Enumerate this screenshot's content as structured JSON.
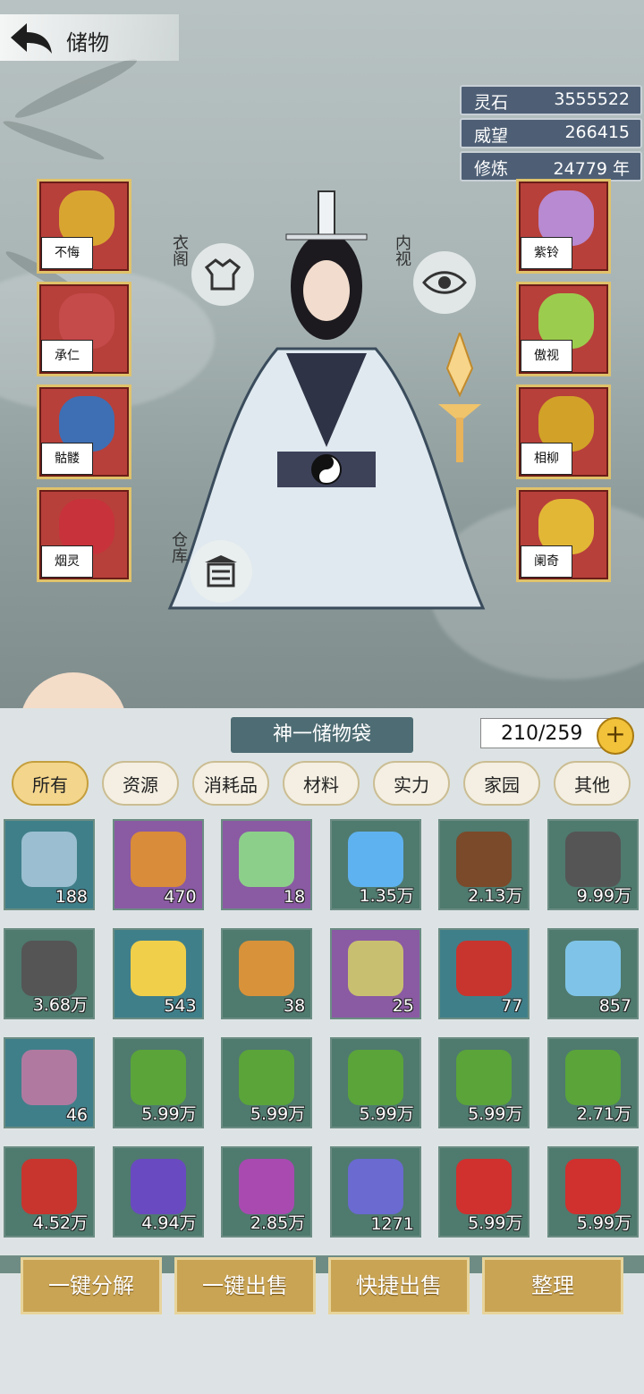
{
  "header": {
    "title": "储物"
  },
  "resources": [
    {
      "label": "灵石",
      "value": "3555522"
    },
    {
      "label": "威望",
      "value": "266415"
    },
    {
      "label": "修炼",
      "value": "24779 年"
    }
  ],
  "buttons": {
    "wardrobe": "衣阁",
    "inner_view": "内视",
    "warehouse": "仓库"
  },
  "equip_left": [
    {
      "seal": "不悔",
      "icon": "golden-sword-icon",
      "color": "#d9a531"
    },
    {
      "seal": "承仁",
      "icon": "helmet-icon",
      "color": "#c54a4a"
    },
    {
      "seal": "骷髅",
      "icon": "armor-icon",
      "color": "#3e6fb4"
    },
    {
      "seal": "烟灵",
      "icon": "boots-icon",
      "color": "#c8323a"
    }
  ],
  "equip_right": [
    {
      "seal": "紫铃",
      "icon": "ring-icon",
      "color": "#b78ad1"
    },
    {
      "seal": "傲视",
      "icon": "flower-pendant-icon",
      "color": "#9ccc4e"
    },
    {
      "seal": "相柳",
      "icon": "claw-ring-icon",
      "color": "#d1a227"
    },
    {
      "seal": "阑奇",
      "icon": "amulet-icon",
      "color": "#e2b736"
    }
  ],
  "bag": {
    "name": "神一储物袋",
    "capacity": "210/259"
  },
  "tabs": [
    "所有",
    "资源",
    "消耗品",
    "材料",
    "实力",
    "家园",
    "其他"
  ],
  "items": [
    {
      "icon": "spirit-crystal-icon",
      "count": "188",
      "bg": "#3f7f8a",
      "c": "#9bbfd0"
    },
    {
      "icon": "scroll-icon",
      "count": "470",
      "bg": "#8a5aa3",
      "c": "#d98c3a"
    },
    {
      "icon": "jade-icon",
      "count": "18",
      "bg": "#8a5aa3",
      "c": "#8ccf8a"
    },
    {
      "icon": "blue-crystal-icon",
      "count": "1.35万",
      "bg": "#4f7a6e",
      "c": "#5fb2f0"
    },
    {
      "icon": "root-icon",
      "count": "2.13万",
      "bg": "#4f7a6e",
      "c": "#7a4a2a"
    },
    {
      "icon": "ore-icon",
      "count": "9.99万",
      "bg": "#4f7a6e",
      "c": "#555"
    },
    {
      "icon": "ore-icon",
      "count": "3.68万",
      "bg": "#4f7a6e",
      "c": "#555"
    },
    {
      "icon": "star-orb-icon",
      "count": "543",
      "bg": "#3f7f8a",
      "c": "#f0cf4a"
    },
    {
      "icon": "gift-box-icon",
      "count": "38",
      "bg": "#4f7a6e",
      "c": "#d8923a"
    },
    {
      "icon": "insect-icon",
      "count": "25",
      "bg": "#8a5aa3",
      "c": "#c8c070"
    },
    {
      "icon": "red-gift-box-icon",
      "count": "77",
      "bg": "#3f7f8a",
      "c": "#c8352e"
    },
    {
      "icon": "ice-crystal-icon",
      "count": "857",
      "bg": "#4f7a6e",
      "c": "#7fc4e8"
    },
    {
      "icon": "crystal-ball-icon",
      "count": "46",
      "bg": "#3f7f8a",
      "c": "#b07aa0"
    },
    {
      "icon": "herb-icon",
      "count": "5.99万",
      "bg": "#4f7a6e",
      "c": "#5aa43a"
    },
    {
      "icon": "herb-icon",
      "count": "5.99万",
      "bg": "#4f7a6e",
      "c": "#5aa43a"
    },
    {
      "icon": "herb-icon",
      "count": "5.99万",
      "bg": "#4f7a6e",
      "c": "#5aa43a"
    },
    {
      "icon": "herb-icon",
      "count": "5.99万",
      "bg": "#4f7a6e",
      "c": "#5aa43a"
    },
    {
      "icon": "herb-icon",
      "count": "2.71万",
      "bg": "#4f7a6e",
      "c": "#5aa43a"
    },
    {
      "icon": "red-berry-icon",
      "count": "4.52万",
      "bg": "#4f7a6e",
      "c": "#c8352e"
    },
    {
      "icon": "purple-flower-icon",
      "count": "4.94万",
      "bg": "#4f7a6e",
      "c": "#6a4ac0"
    },
    {
      "icon": "pink-flower-icon",
      "count": "2.85万",
      "bg": "#4f7a6e",
      "c": "#a84ab0"
    },
    {
      "icon": "grape-icon",
      "count": "1271",
      "bg": "#4f7a6e",
      "c": "#6a6ad0"
    },
    {
      "icon": "red-flower-icon",
      "count": "5.99万",
      "bg": "#4f7a6e",
      "c": "#d0302e"
    },
    {
      "icon": "red-flower-icon",
      "count": "5.99万",
      "bg": "#4f7a6e",
      "c": "#d0302e"
    }
  ],
  "actions": [
    "一键分解",
    "一键出售",
    "快捷出售",
    "整理"
  ],
  "colors": {
    "accent": "#c9a454",
    "tab_active": "#f3d58c",
    "resource_bg": "#4e5f75"
  }
}
